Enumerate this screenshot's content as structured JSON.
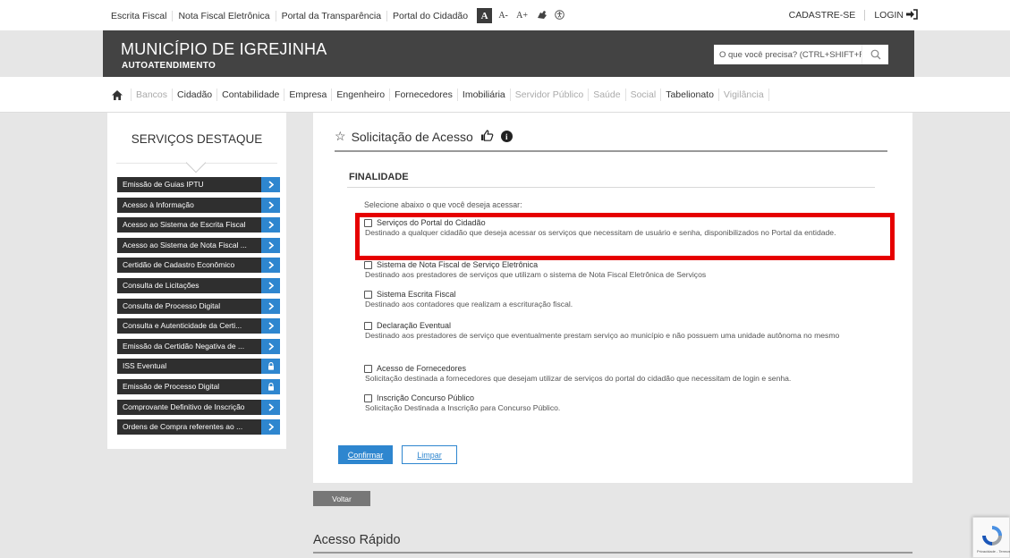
{
  "top_links": [
    "Escrita Fiscal",
    "Nota Fiscal Eletrônica",
    "Portal da Transparência",
    "Portal do Cidadão"
  ],
  "font_size": {
    "normal": "A",
    "decrease": "A-",
    "increase": "A+"
  },
  "top_right": {
    "cadastre": "CADASTRE-SE",
    "login": "LOGIN"
  },
  "header": {
    "title": "MUNICÍPIO DE IGREJINHA",
    "subtitle": "AUTOATENDIMENTO",
    "search_placeholder": "O que você precisa? (CTRL+SHIFT+F)"
  },
  "nav": {
    "items": [
      {
        "label": "Bancos",
        "disabled": true
      },
      {
        "label": "Cidadão",
        "disabled": false
      },
      {
        "label": "Contabilidade",
        "disabled": false
      },
      {
        "label": "Empresa",
        "disabled": false
      },
      {
        "label": "Engenheiro",
        "disabled": false
      },
      {
        "label": "Fornecedores",
        "disabled": false
      },
      {
        "label": "Imobiliária",
        "disabled": false
      },
      {
        "label": "Servidor Público",
        "disabled": true
      },
      {
        "label": "Saúde",
        "disabled": true
      },
      {
        "label": "Social",
        "disabled": true
      },
      {
        "label": "Tabelionato",
        "disabled": false
      },
      {
        "label": "Vigilância",
        "disabled": true
      }
    ]
  },
  "sidebar": {
    "title": "SERVIÇOS DESTAQUE",
    "items": [
      {
        "label": "Emissão de Guias IPTU",
        "icon": "arrow"
      },
      {
        "label": "Acesso à Informação",
        "icon": "arrow"
      },
      {
        "label": "Acesso ao Sistema de Escrita Fiscal",
        "icon": "arrow"
      },
      {
        "label": "Acesso ao Sistema de Nota Fiscal ...",
        "icon": "arrow"
      },
      {
        "label": "Certidão de Cadastro Econômico",
        "icon": "arrow"
      },
      {
        "label": "Consulta de Licitações",
        "icon": "arrow"
      },
      {
        "label": "Consulta de Processo Digital",
        "icon": "arrow"
      },
      {
        "label": "Consulta e Autenticidade da Certi...",
        "icon": "arrow"
      },
      {
        "label": "Emissão da Certidão Negativa de ...",
        "icon": "arrow"
      },
      {
        "label": "ISS Eventual",
        "icon": "lock"
      },
      {
        "label": "Emissão de Processo Digital",
        "icon": "lock"
      },
      {
        "label": "Comprovante Definitivo de Inscrição",
        "icon": "arrow"
      },
      {
        "label": "Ordens de Compra referentes ao ...",
        "icon": "arrow"
      }
    ]
  },
  "main": {
    "heading": "Solicitação de Acesso",
    "section": "FINALIDADE",
    "instruction": "Selecione abaixo o que você deseja acessar:",
    "options": [
      {
        "title": "Serviços do Portal do Cidadão",
        "desc": "Destinado a qualquer cidadão que deseja acessar os serviços que necessitam de usuário e senha, disponibilizados no Portal da entidade."
      },
      {
        "title": "Sistema de Nota Fiscal de Serviço Eletrônica",
        "desc": "Destinado aos prestadores de serviços que utilizam o sistema de Nota Fiscal Eletrônica de Serviços"
      },
      {
        "title": "Sistema Escrita Fiscal",
        "desc": "Destinado aos contadores que realizam a escrituração fiscal."
      },
      {
        "title": "Declaração Eventual",
        "desc": "Destinado aos prestadores de serviço que eventualmente prestam serviço ao município e não possuem uma unidade autônoma no mesmo"
      },
      {
        "title": "Acesso de Fornecedores",
        "desc": "Solicitação destinada a fornecedores que desejam utilizar de serviços do portal do cidadão que necessitam de login e senha."
      },
      {
        "title": "Inscrição Concurso Público",
        "desc": "Solicitação Destinada a Inscrição para Concurso Público."
      }
    ],
    "confirm_label": "Confirmar",
    "clear_label": "Limpar"
  },
  "back_label": "Voltar",
  "quick_access": "Acesso Rápido",
  "colors": {
    "accent": "#2e86cf",
    "dark": "#434343",
    "highlight": "#e60000"
  }
}
